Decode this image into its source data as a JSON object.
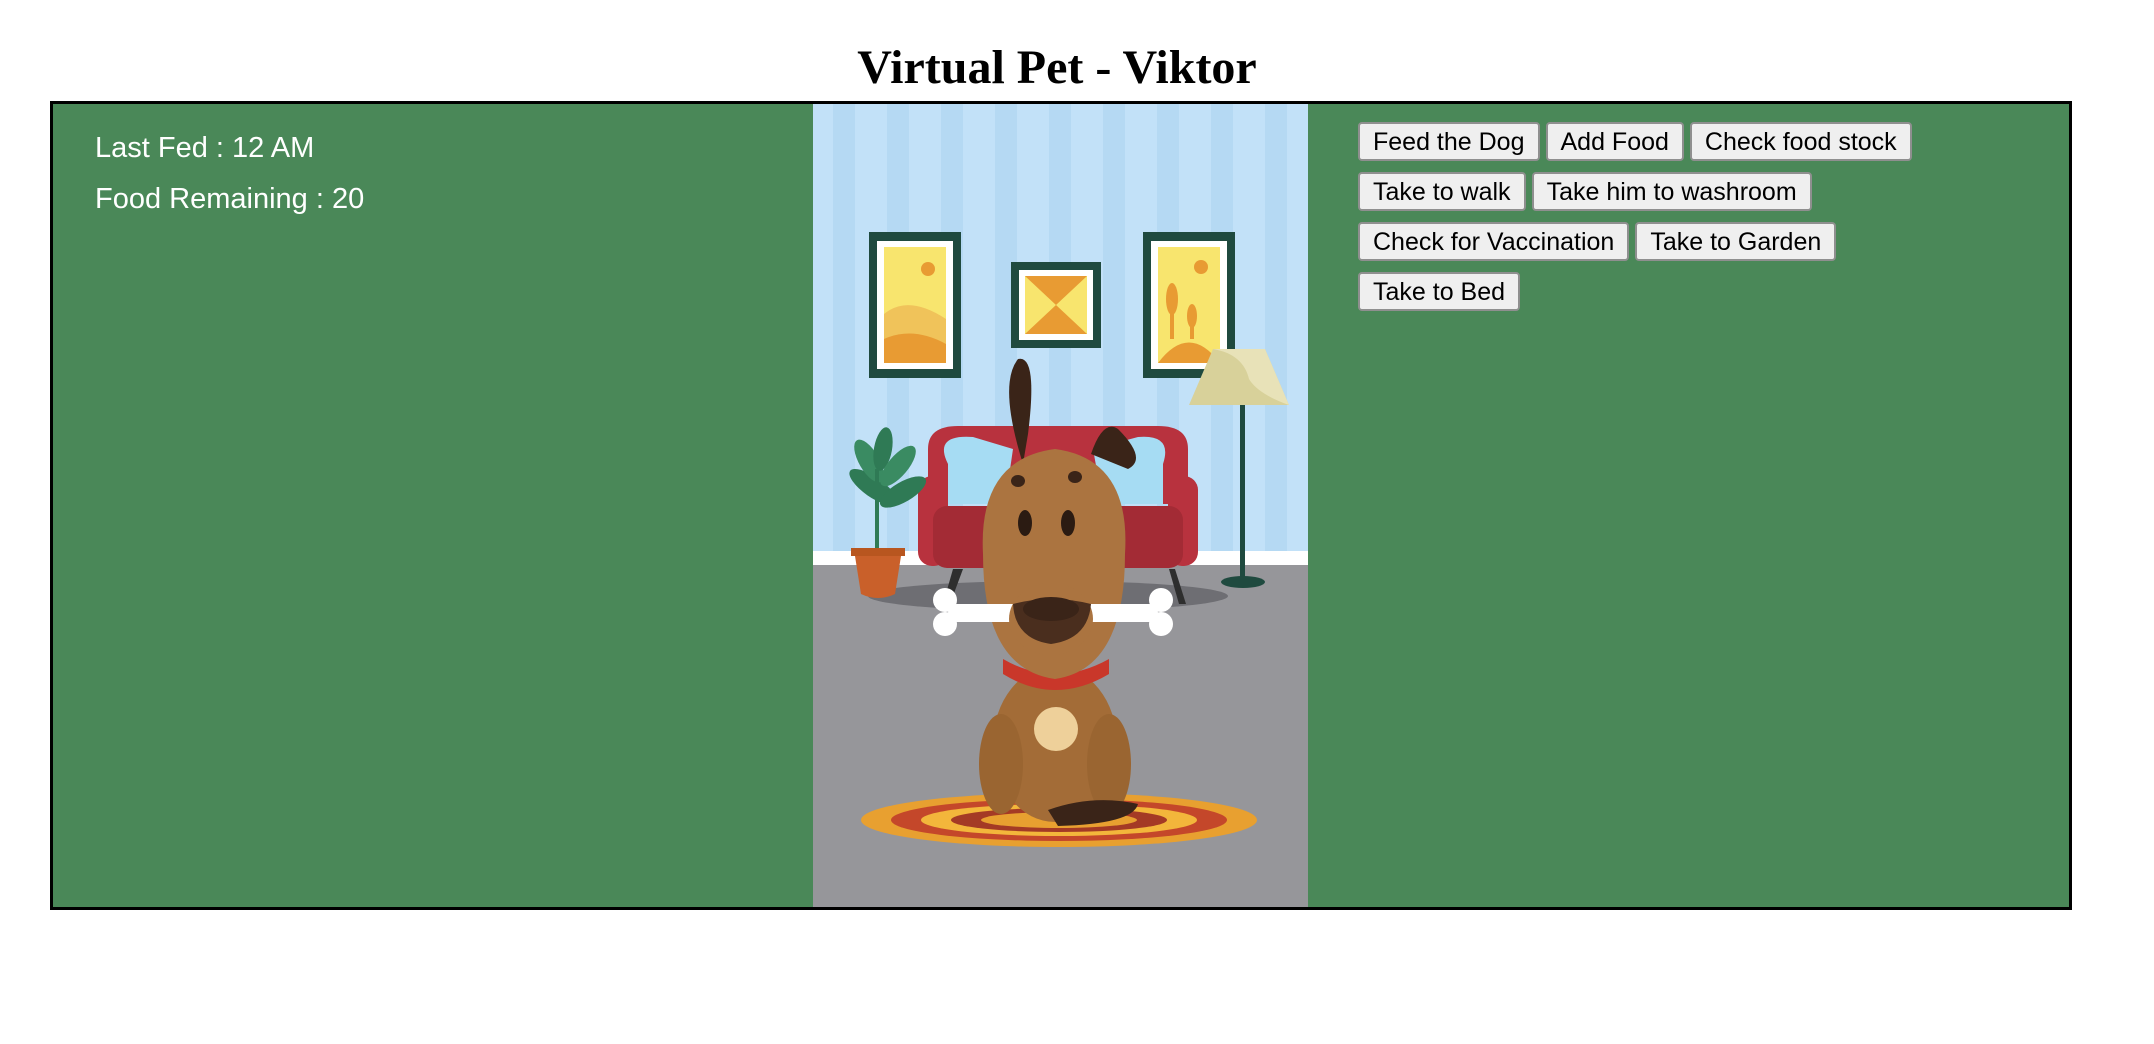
{
  "page": {
    "title": "Virtual Pet - Viktor"
  },
  "status": {
    "last_fed": "Last Fed : 12 AM",
    "food_remaining": "Food Remaining : 20"
  },
  "actions": {
    "feed": "Feed the Dog",
    "add_food": "Add Food",
    "check_stock": "Check food stock",
    "walk": "Take to walk",
    "washroom": "Take him to washroom",
    "vaccination": "Check for Vaccination",
    "garden": "Take to Garden",
    "bed": "Take to Bed"
  },
  "colors": {
    "panel": "#4a8858",
    "wall": "#c2e1f8",
    "floor": "#96969a",
    "sofa": "#b8323e",
    "dog": "#ab7440"
  }
}
